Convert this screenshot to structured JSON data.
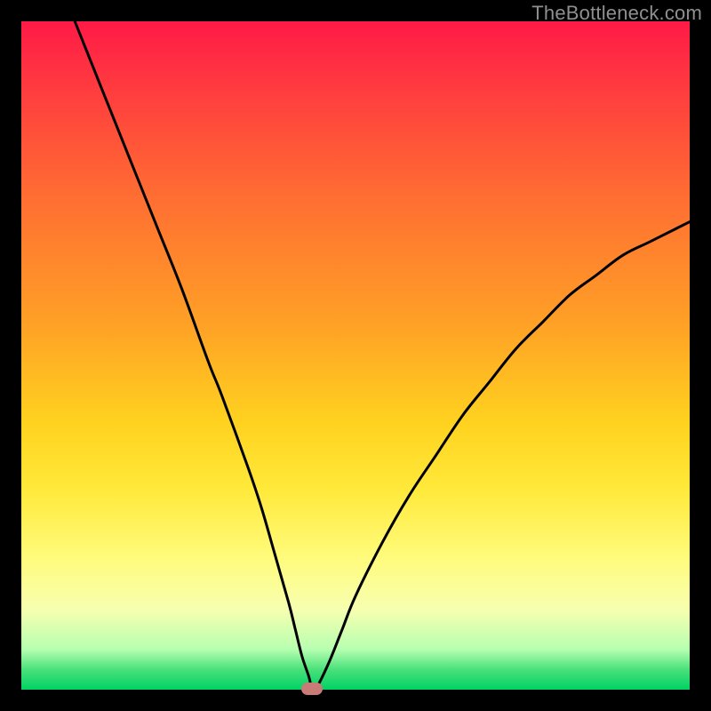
{
  "watermark": "TheBottleneck.com",
  "colors": {
    "frame": "#000000",
    "curve": "#000000",
    "marker": "#c97b78",
    "gradient_top": "#ff1a47",
    "gradient_bottom": "#00d264"
  },
  "chart_data": {
    "type": "line",
    "title": "",
    "xlabel": "",
    "ylabel": "",
    "xlim": [
      0,
      100
    ],
    "ylim": [
      0,
      100
    ],
    "grid": false,
    "legend": false,
    "series": [
      {
        "name": "bottleneck-curve",
        "x": [
          8,
          12,
          16,
          20,
          24,
          28,
          30,
          34,
          36,
          38,
          40,
          41,
          42,
          43,
          43.5,
          44,
          46,
          48,
          50,
          54,
          58,
          62,
          66,
          70,
          74,
          78,
          82,
          86,
          90,
          94,
          98,
          100
        ],
        "y": [
          100,
          90,
          80,
          70,
          60,
          49,
          44,
          33,
          27,
          20,
          13,
          9,
          5,
          2,
          0,
          0,
          4,
          9,
          14,
          22,
          29,
          35,
          41,
          46,
          51,
          55,
          59,
          62,
          65,
          67,
          69,
          70
        ]
      }
    ],
    "marker": {
      "x": 43.5,
      "y": 0,
      "shape": "rounded-rect"
    },
    "background_gradient": {
      "direction": "vertical",
      "stops": [
        {
          "pos": 0,
          "color": "#ff1a47"
        },
        {
          "pos": 10,
          "color": "#ff3b3f"
        },
        {
          "pos": 25,
          "color": "#ff6a33"
        },
        {
          "pos": 45,
          "color": "#ffa026"
        },
        {
          "pos": 60,
          "color": "#ffd21f"
        },
        {
          "pos": 70,
          "color": "#ffe93a"
        },
        {
          "pos": 80,
          "color": "#fffb7a"
        },
        {
          "pos": 88,
          "color": "#f7ffb0"
        },
        {
          "pos": 94,
          "color": "#b6ffb0"
        },
        {
          "pos": 97,
          "color": "#49e07a"
        },
        {
          "pos": 100,
          "color": "#00d264"
        }
      ]
    }
  }
}
